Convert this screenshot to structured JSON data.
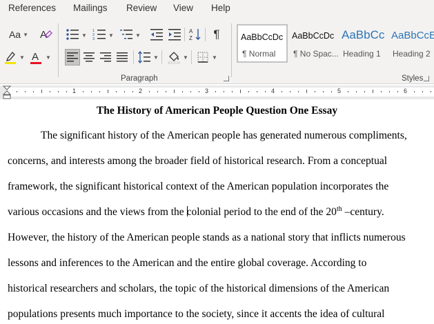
{
  "menu": {
    "tabs": [
      "References",
      "Mailings",
      "Review",
      "View",
      "Help"
    ]
  },
  "ribbon": {
    "font_size_label": "Aa",
    "paragraph_group_label": "Paragraph",
    "styles_group_label": "Styles",
    "highlight_color": "#f5e400",
    "font_color": "#e81123"
  },
  "styles": [
    {
      "sample": "AaBbCcDc",
      "name": "¶ Normal"
    },
    {
      "sample": "AaBbCcDc",
      "name": "¶ No Spac..."
    },
    {
      "sample": "AaBbCc",
      "name": "Heading 1"
    },
    {
      "sample": "AaBbCcE",
      "name": "Heading 2"
    }
  ],
  "ruler": {
    "numbers": [
      "1",
      "2",
      "3",
      "4",
      "5",
      "6"
    ]
  },
  "document": {
    "title": "The History of American People Question One Essay",
    "lines": [
      "The significant history of the American people has generated numerous compliments,",
      "concerns, and interests among the broader field of historical research. From a conceptual",
      "framework, the significant historical context of the American population incorporates the",
      "various occasions and the views from the ",
      "colonial period to the end of the 20",
      "th",
      " –century.",
      "However, the history of the American people stands as a national story that inflicts numerous",
      "lessons and inferences to the American and the entire global coverage. According to",
      "historical researchers and scholars, the topic of the historical dimensions of the American",
      "populations presents much importance to the society, since it accents the idea of cultural"
    ]
  }
}
